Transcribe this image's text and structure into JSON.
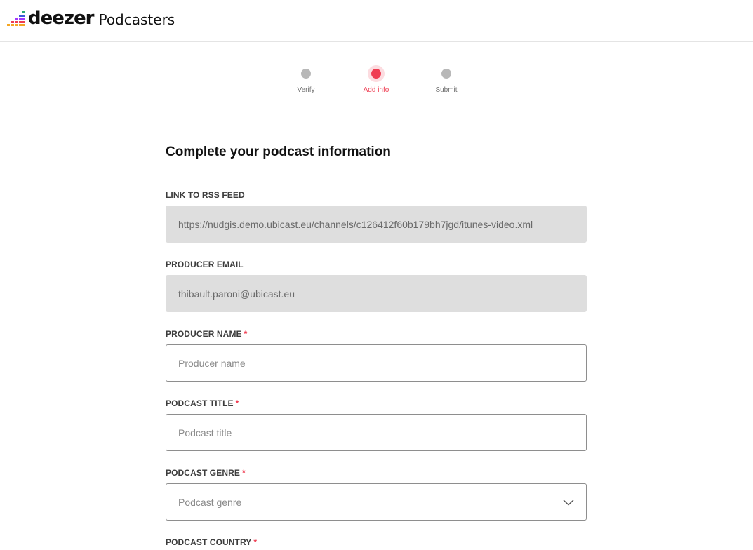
{
  "header": {
    "brand": "deezer",
    "product": "Podcasters",
    "logo_colors": [
      "#f5a623",
      "#ef3d52",
      "#a238ff",
      "#3b5bdb",
      "#2aa876"
    ]
  },
  "stepper": {
    "steps": [
      {
        "label": "Verify",
        "state": "done"
      },
      {
        "label": "Add info",
        "state": "active"
      },
      {
        "label": "Submit",
        "state": "pending"
      }
    ],
    "active_color": "#ef3d52"
  },
  "form": {
    "title": "Complete your podcast information",
    "required_marker": "*",
    "rss": {
      "label": "LINK TO RSS FEED",
      "value": "https://nudgis.demo.ubicast.eu/channels/c126412f60b179bh7jgd/itunes-video.xml"
    },
    "email": {
      "label": "PRODUCER EMAIL",
      "value": "thibault.paroni@ubicast.eu"
    },
    "producer_name": {
      "label": "PRODUCER NAME",
      "placeholder": "Producer name"
    },
    "podcast_title": {
      "label": "PODCAST TITLE",
      "placeholder": "Podcast title"
    },
    "podcast_genre": {
      "label": "PODCAST GENRE",
      "placeholder": "Podcast genre",
      "icon": "chevron-down-icon"
    },
    "podcast_country": {
      "label": "PODCAST COUNTRY"
    }
  }
}
